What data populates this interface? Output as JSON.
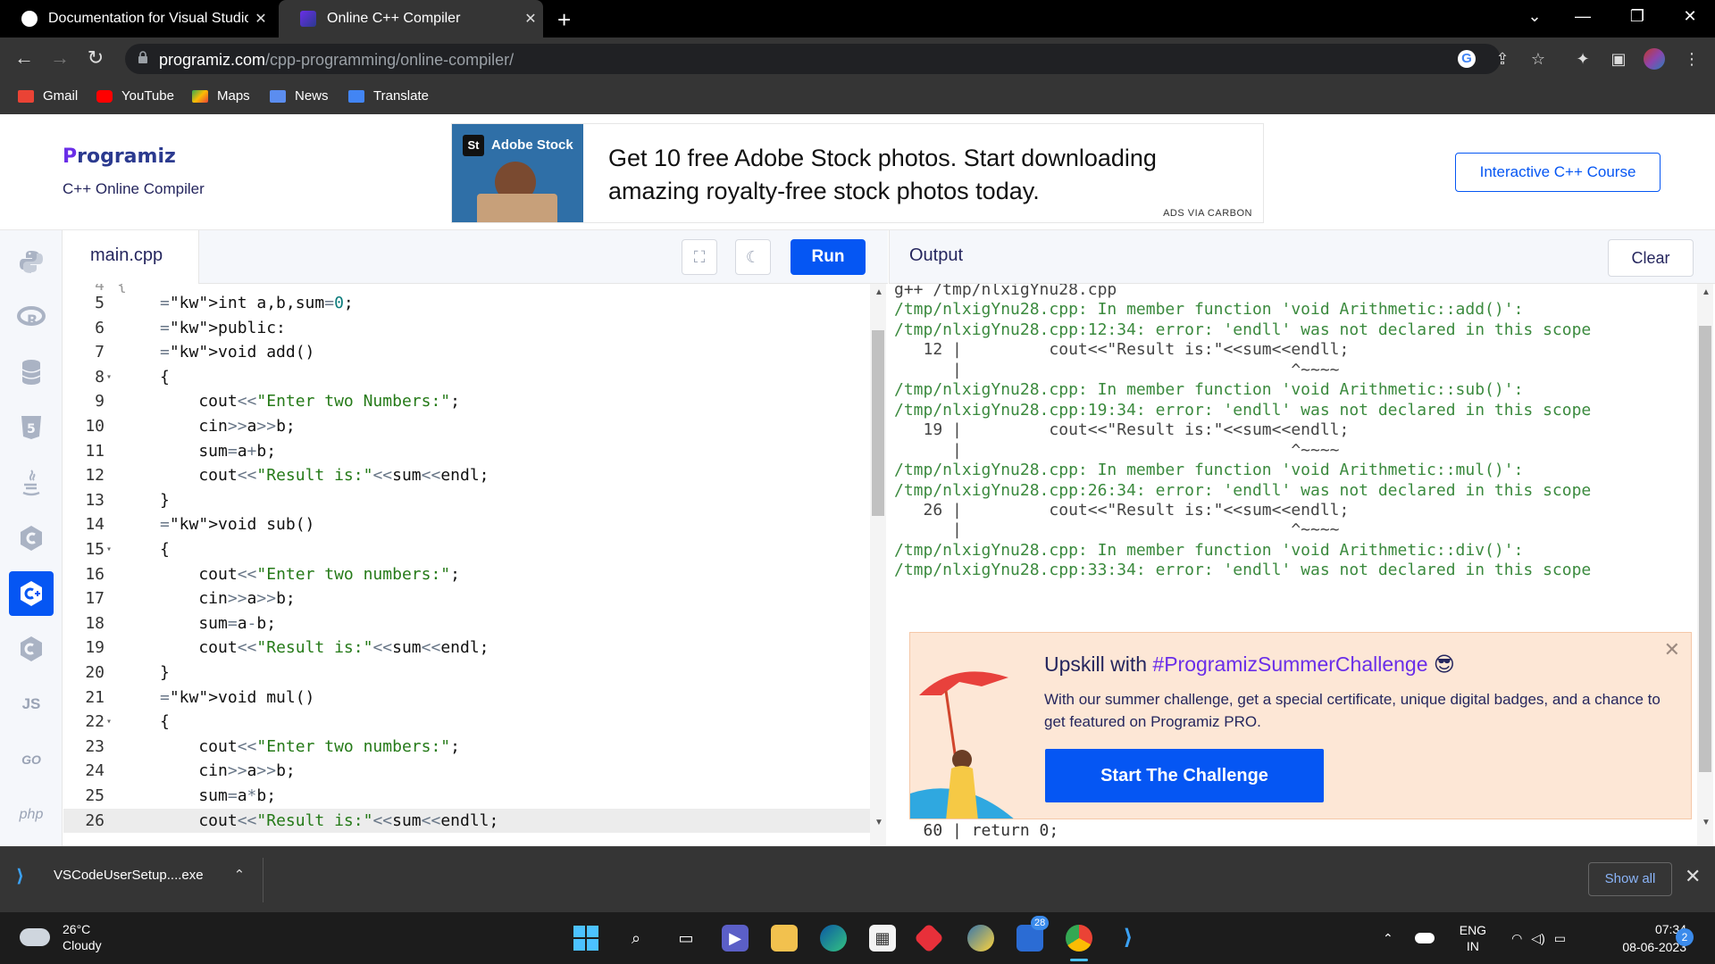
{
  "browser": {
    "tabs": [
      {
        "title": "Documentation for Visual Studio"
      },
      {
        "title": "Online C++ Compiler"
      }
    ],
    "url_host": "programiz.com",
    "url_path": "/cpp-programming/online-compiler/",
    "bookmarks": [
      "Gmail",
      "YouTube",
      "Maps",
      "News",
      "Translate"
    ]
  },
  "header": {
    "logo": "rogramiz",
    "logo_p": "P",
    "subtitle": "C++ Online Compiler",
    "ad_brand": "Adobe Stock",
    "ad_brand_mark": "St",
    "ad_text": "Get 10 free Adobe Stock photos. Start downloading amazing royalty-free stock photos today.",
    "ad_badge": "ADS VIA CARBON",
    "course_button": "Interactive C++ Course"
  },
  "languages": [
    "python-icon",
    "r-icon",
    "sql-icon",
    "html-icon",
    "java-icon",
    "c-icon",
    "cpp-icon",
    "csharp-icon",
    "JS",
    "GO",
    "php"
  ],
  "editor": {
    "filename": "main.cpp",
    "run_label": "Run",
    "lines": [
      {
        "n": "5",
        "t": "int a,b,sum=0;"
      },
      {
        "n": "6",
        "t": "public:"
      },
      {
        "n": "7",
        "t": "void add()"
      },
      {
        "n": "8",
        "t": "{"
      },
      {
        "n": "9",
        "t": "    cout<<\"Enter two Numbers:\";"
      },
      {
        "n": "10",
        "t": "    cin>>a>>b;"
      },
      {
        "n": "11",
        "t": "    sum=a+b;"
      },
      {
        "n": "12",
        "t": "    cout<<\"Result is:\"<<sum<<endl;"
      },
      {
        "n": "13",
        "t": "}"
      },
      {
        "n": "14",
        "t": "void sub()"
      },
      {
        "n": "15",
        "t": "{"
      },
      {
        "n": "16",
        "t": "    cout<<\"Enter two numbers:\";"
      },
      {
        "n": "17",
        "t": "    cin>>a>>b;"
      },
      {
        "n": "18",
        "t": "    sum=a-b;"
      },
      {
        "n": "19",
        "t": "    cout<<\"Result is:\"<<sum<<endl;"
      },
      {
        "n": "20",
        "t": "}"
      },
      {
        "n": "21",
        "t": "void mul()"
      },
      {
        "n": "22",
        "t": "{"
      },
      {
        "n": "23",
        "t": "    cout<<\"Enter two numbers:\";"
      },
      {
        "n": "24",
        "t": "    cin>>a>>b;"
      },
      {
        "n": "25",
        "t": "    sum=a*b;"
      },
      {
        "n": "26",
        "t": "    cout<<\"Result is:\"<<sum<<endll;"
      }
    ]
  },
  "output": {
    "title": "Output",
    "clear_label": "Clear",
    "lines": [
      "g++ /tmp/nlxigYnu28.cpp",
      "/tmp/nlxigYnu28.cpp: In member function 'void Arithmetic::add()':",
      "/tmp/nlxigYnu28.cpp:12:34: error: 'endll' was not declared in this scope",
      "   12 |         cout<<\"Result is:\"<<sum<<endll;",
      "      |                                  ^~~~~",
      "/tmp/nlxigYnu28.cpp: In member function 'void Arithmetic::sub()':",
      "/tmp/nlxigYnu28.cpp:19:34: error: 'endll' was not declared in this scope",
      "   19 |         cout<<\"Result is:\"<<sum<<endll;",
      "      |                                  ^~~~~",
      "/tmp/nlxigYnu28.cpp: In member function 'void Arithmetic::mul()':",
      "/tmp/nlxigYnu28.cpp:26:34: error: 'endll' was not declared in this scope",
      "   26 |         cout<<\"Result is:\"<<sum<<endll;",
      "      |                                  ^~~~~",
      "/tmp/nlxigYnu28.cpp: In member function 'void Arithmetic::div()':",
      "/tmp/nlxigYnu28.cpp:33:34: error: 'endll' was not declared in this scope"
    ],
    "last_line": "   60 | return 0;"
  },
  "popup": {
    "title_prefix": "Upskill with ",
    "title_tag": "#ProgramizSummerChallenge",
    "title_emoji": "😎",
    "description": "With our summer challenge, get a special certificate, unique digital badges, and a chance to get featured on Programiz PRO.",
    "button": "Start The Challenge"
  },
  "download": {
    "filename": "VSCodeUserSetup....exe",
    "show_all": "Show all"
  },
  "taskbar": {
    "temperature": "26°C",
    "condition": "Cloudy",
    "lang_top": "ENG",
    "lang_bottom": "IN",
    "time": "07:34",
    "date": "08-06-2023",
    "notifications": "2",
    "teams_badge": "28"
  }
}
